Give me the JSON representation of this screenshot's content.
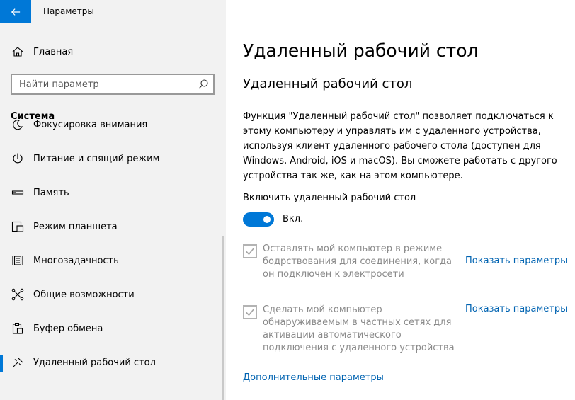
{
  "window": {
    "title": "Параметры"
  },
  "sidebar": {
    "home_label": "Главная",
    "search": {
      "placeholder": "Найти параметр",
      "value": ""
    },
    "section_title": "Система",
    "items": [
      {
        "label": "Фокусировка внимания",
        "icon": "moon-icon"
      },
      {
        "label": "Питание и спящий режим",
        "icon": "power-icon"
      },
      {
        "label": "Память",
        "icon": "storage-icon"
      },
      {
        "label": "Режим планшета",
        "icon": "tablet-mode-icon"
      },
      {
        "label": "Многозадачность",
        "icon": "multitasking-icon"
      },
      {
        "label": "Общие возможности",
        "icon": "shared-experiences-icon"
      },
      {
        "label": "Буфер обмена",
        "icon": "clipboard-icon"
      },
      {
        "label": "Удаленный рабочий стол",
        "icon": "remote-desktop-icon",
        "active": true
      }
    ]
  },
  "main": {
    "page_title": "Удаленный рабочий стол",
    "section_heading": "Удаленный рабочий стол",
    "description": "Функция \"Удаленный рабочий стол\" позволяет подключаться к этому компьютеру и управлять им с удаленного устройства, используя клиент удаленного рабочего стола (доступен для Windows, Android, iOS и macOS). Вы сможете работать с другого устройства так же, как на этом компьютере.",
    "toggle": {
      "label": "Включить удаленный рабочий стол",
      "state_text": "Вкл.",
      "on": true
    },
    "options": [
      {
        "text": "Оставлять мой компьютер в режиме бодрствования для соединения, когда он подключен к электросети",
        "link": "Показать параметры",
        "checked": true,
        "disabled": true
      },
      {
        "text": "Сделать мой компьютер обнаруживаемым в частных сетях для активации автоматического подключения с удаленного устройства",
        "link": "Показать параметры",
        "checked": true,
        "disabled": true
      }
    ],
    "advanced_link": "Дополнительные параметры"
  },
  "colors": {
    "accent": "#0078d7",
    "link": "#0063b1",
    "sidebar_bg": "#f2f2f2",
    "disabled_text": "#8a8a8a"
  }
}
